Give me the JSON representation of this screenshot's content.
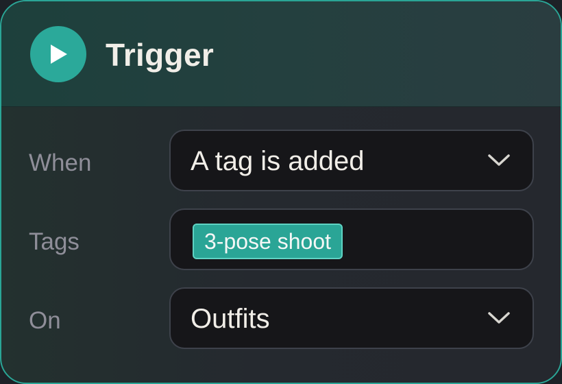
{
  "header": {
    "title": "Trigger",
    "icon": "play-icon",
    "accent_color": "#2ba99a"
  },
  "fields": {
    "when": {
      "label": "When",
      "value": "A tag is added"
    },
    "tags": {
      "label": "Tags",
      "chips": [
        "3-pose shoot"
      ]
    },
    "on": {
      "label": "On",
      "value": "Outfits"
    }
  }
}
